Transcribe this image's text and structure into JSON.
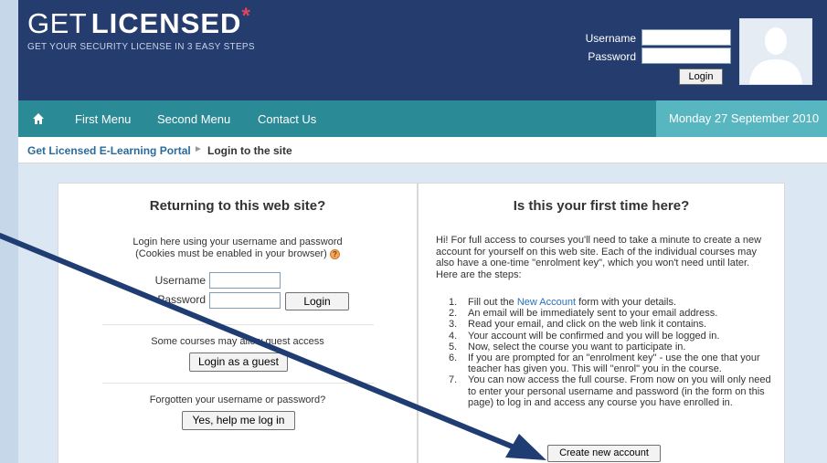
{
  "header": {
    "logo_get": "GET",
    "logo_licensed": "LICENSED",
    "logo_star": "*",
    "tagline": "GET YOUR SECURITY LICENSE IN 3 EASY STEPS",
    "username_label": "Username",
    "password_label": "Password",
    "login_button": "Login"
  },
  "nav": {
    "items": [
      "First Menu",
      "Second Menu",
      "Contact Us"
    ],
    "date": "Monday 27 September 2010"
  },
  "breadcrumb": {
    "home": "Get Licensed E-Learning Portal",
    "separator": "►",
    "current": "Login to the site"
  },
  "returning": {
    "title": "Returning to this web site?",
    "intro_line1": "Login here using your username and password",
    "intro_line2": "(Cookies must be enabled in your browser)",
    "help_icon_text": "?",
    "username_label": "Username",
    "password_label": "Password",
    "login_button": "Login",
    "guest_text": "Some courses may allow guest access",
    "guest_button": "Login as a guest",
    "forgot_text": "Forgotten your username or password?",
    "forgot_button": "Yes, help me log in"
  },
  "first_time": {
    "title": "Is this your first time here?",
    "intro": "Hi! For full access to courses you'll need to take a minute to create a new account for yourself on this web site. Each of the individual courses may also have a one-time \"enrolment key\", which you won't need until later. Here are the steps:",
    "steps": [
      {
        "num": "1.",
        "before": "Fill out the ",
        "link": "New Account",
        "after": " form with your details."
      },
      {
        "num": "2.",
        "before": "An email will be immediately sent to your email address.",
        "link": "",
        "after": ""
      },
      {
        "num": "3.",
        "before": "Read your email, and click on the web link it contains.",
        "link": "",
        "after": ""
      },
      {
        "num": "4.",
        "before": "Your account will be confirmed and you will be logged in.",
        "link": "",
        "after": ""
      },
      {
        "num": "5.",
        "before": "Now, select the course you want to participate in.",
        "link": "",
        "after": ""
      },
      {
        "num": "6.",
        "before": "If you are prompted for an \"enrolment key\" - use the one that your teacher has given you. This will \"enrol\" you in the course.",
        "link": "",
        "after": ""
      },
      {
        "num": "7.",
        "before": "You can now access the full course. From now on you will only need to enter your personal username and password (in the form on this page) to log in and access any course you have enrolled in.",
        "link": "",
        "after": ""
      }
    ],
    "create_button": "Create new account"
  },
  "colors": {
    "header_bg": "#253c6e",
    "nav_bg": "#2a8a95",
    "date_bg": "#58b6c0",
    "accent_star": "#e2445b",
    "arrow": "#1f3d73"
  },
  "icons": [
    "home-icon",
    "user-silhouette-icon",
    "help-icon",
    "arrow-icon"
  ]
}
